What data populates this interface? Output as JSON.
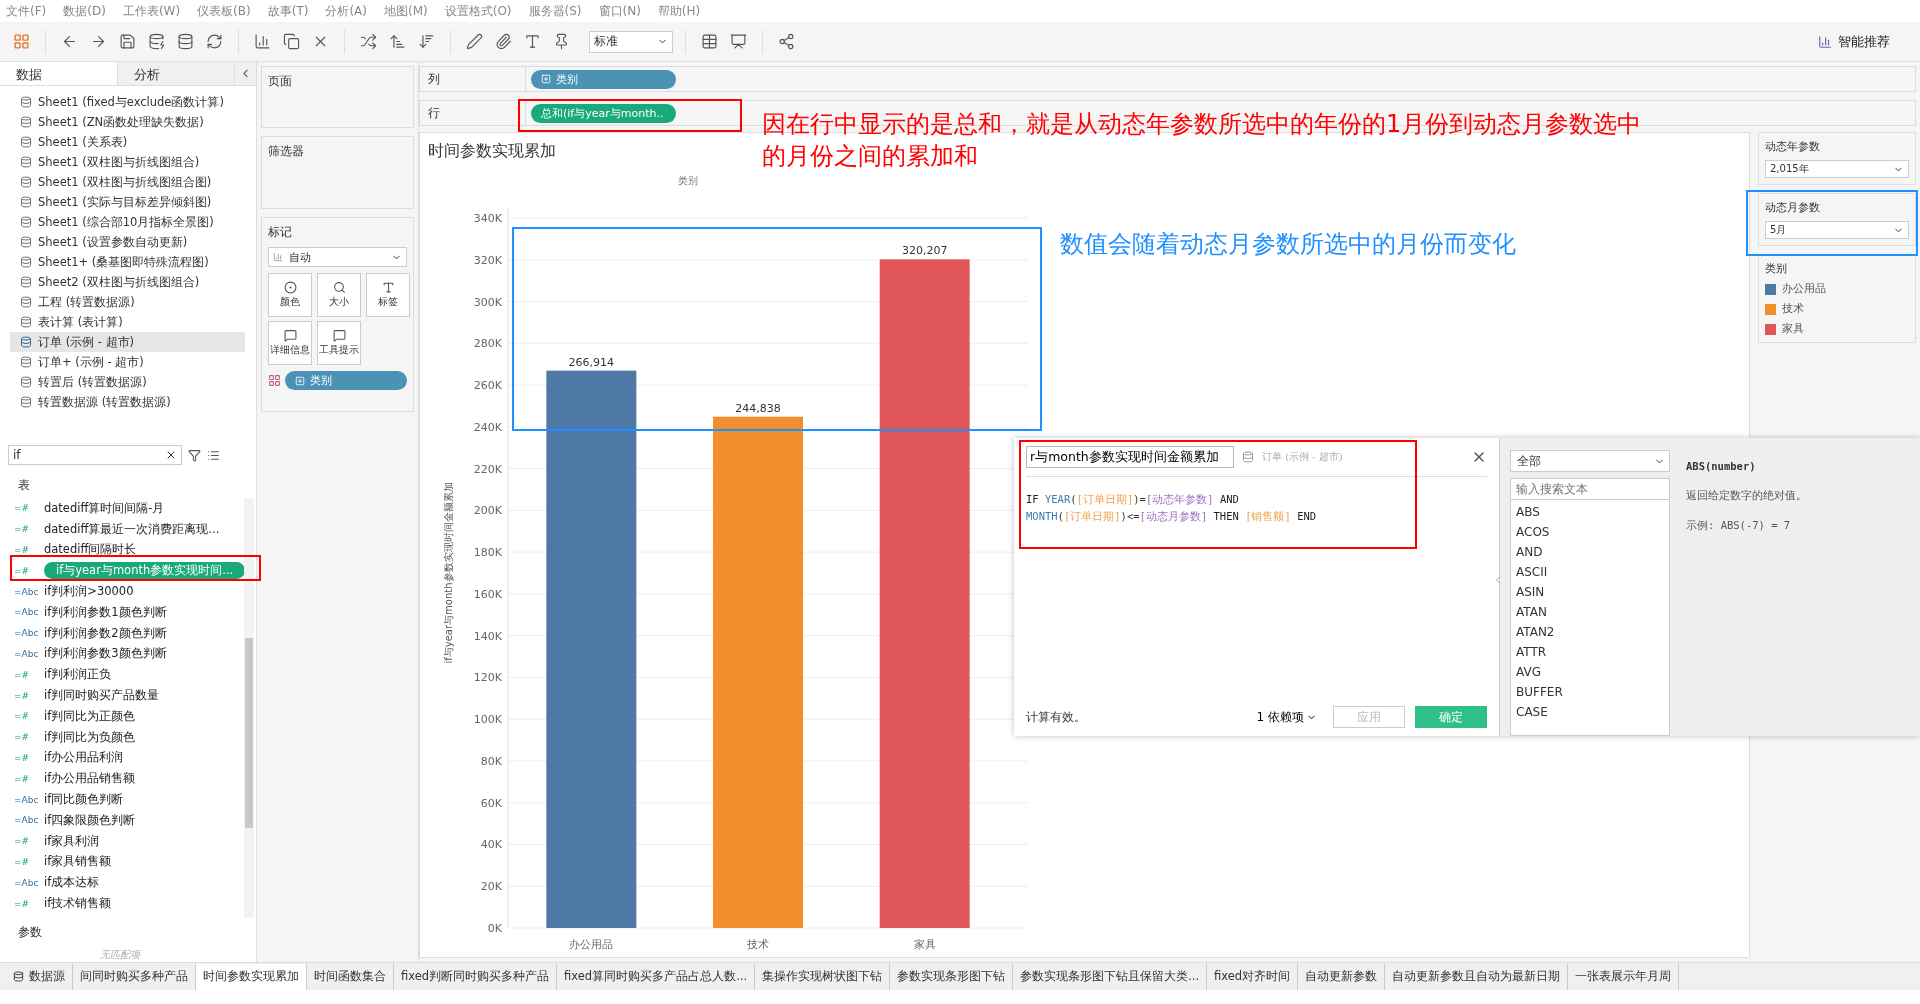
{
  "menu": [
    "文件(F)",
    "数据(D)",
    "工作表(W)",
    "仪表板(B)",
    "故事(T)",
    "分析(A)",
    "地图(M)",
    "设置格式(O)",
    "服务器(S)",
    "窗口(N)",
    "帮助(H)"
  ],
  "toolbar": {
    "fit_select": "标准",
    "smart_button": "智能推荐"
  },
  "data_pane": {
    "tabs": [
      {
        "label": "数据",
        "selected": true
      },
      {
        "label": "分析",
        "selected": false
      }
    ],
    "sources": [
      {
        "name": "Sheet1 (fixed与exclude函数计算)",
        "selected": false
      },
      {
        "name": "Sheet1 (ZN函数处理缺失数据)",
        "selected": false
      },
      {
        "name": "Sheet1 (关系表)",
        "selected": false
      },
      {
        "name": "Sheet1 (双柱图与折线图组合)",
        "selected": false
      },
      {
        "name": "Sheet1 (双柱图与折线图组合图)",
        "selected": false
      },
      {
        "name": "Sheet1 (实际与目标差异倾斜图)",
        "selected": false
      },
      {
        "name": "Sheet1 (综合部10月指标全景图)",
        "selected": false
      },
      {
        "name": "Sheet1 (设置参数自动更新)",
        "selected": false
      },
      {
        "name": "Sheet1+ (桑基图即特殊流程图)",
        "selected": false
      },
      {
        "name": "Sheet2 (双柱图与折线图组合)",
        "selected": false
      },
      {
        "name": "工程 (转置数据源)",
        "selected": false
      },
      {
        "name": "表计算 (表计算)",
        "selected": false
      },
      {
        "name": "订单 (示例 - 超市)",
        "selected": true
      },
      {
        "name": "订单+ (示例 - 超市)",
        "selected": false
      },
      {
        "name": "转置后 (转置数据源)",
        "selected": false
      },
      {
        "name": "转置数据源 (转置数据源)",
        "selected": false
      }
    ],
    "search": {
      "value": "if"
    },
    "table_heading": "表",
    "fields": [
      {
        "kind": "measure",
        "type_icon": "=#",
        "name": "datediff算时间间隔-月",
        "selected": false
      },
      {
        "kind": "measure",
        "type_icon": "=#",
        "name": "datediff算最近一次消费距离现...",
        "selected": false
      },
      {
        "kind": "measure",
        "type_icon": "=#",
        "name": "datediff间隔时长",
        "selected": false
      },
      {
        "kind": "measure",
        "type_icon": "=#",
        "name": "if与year与month参数实现时间...",
        "selected": true
      },
      {
        "kind": "dimension",
        "type_icon": "=Abc",
        "name": "if判利润>30000",
        "selected": false
      },
      {
        "kind": "dimension",
        "type_icon": "=Abc",
        "name": "if判利润参数1颜色判断",
        "selected": false
      },
      {
        "kind": "dimension",
        "type_icon": "=Abc",
        "name": "if判利润参数2颜色判断",
        "selected": false
      },
      {
        "kind": "dimension",
        "type_icon": "=Abc",
        "name": "if判利润参数3颜色判断",
        "selected": false
      },
      {
        "kind": "measure",
        "type_icon": "=#",
        "name": "if判利润正负",
        "selected": false
      },
      {
        "kind": "measure",
        "type_icon": "=#",
        "name": "if判同时购买产品数量",
        "selected": false
      },
      {
        "kind": "measure",
        "type_icon": "=#",
        "name": "if判同比为正颜色",
        "selected": false
      },
      {
        "kind": "measure",
        "type_icon": "=#",
        "name": "if判同比为负颜色",
        "selected": false
      },
      {
        "kind": "measure",
        "type_icon": "=#",
        "name": "if办公用品利润",
        "selected": false
      },
      {
        "kind": "measure",
        "type_icon": "=#",
        "name": "if办公用品销售额",
        "selected": false
      },
      {
        "kind": "dimension",
        "type_icon": "=Abc",
        "name": "if同比颜色判断",
        "selected": false
      },
      {
        "kind": "dimension",
        "type_icon": "=Abc",
        "name": "if四象限颜色判断",
        "selected": false
      },
      {
        "kind": "measure",
        "type_icon": "=#",
        "name": "if家具利润",
        "selected": false
      },
      {
        "kind": "measure",
        "type_icon": "=#",
        "name": "if家具销售额",
        "selected": false
      },
      {
        "kind": "dimension",
        "type_icon": "=Abc",
        "name": "if成本达标",
        "selected": false
      },
      {
        "kind": "measure",
        "type_icon": "=#",
        "name": "if技术销售额",
        "selected": false
      }
    ],
    "params_heading": "参数",
    "no_match": "无匹配项"
  },
  "cards": {
    "pages": "页面",
    "filters": "筛选器",
    "marks": {
      "title": "标记",
      "mark_type": "自动",
      "buttons": [
        "颜色",
        "大小",
        "标签",
        "详细信息",
        "工具提示"
      ],
      "pill": "类别"
    }
  },
  "shelves": [
    {
      "label": "列",
      "pill": "类别",
      "kind": "dimension"
    },
    {
      "label": "行",
      "pill": "总和(if与year与month..",
      "kind": "measure"
    }
  ],
  "view": {
    "title": "时间参数实现累加",
    "header": "类别",
    "chart_data": {
      "type": "bar",
      "ylabel": "if与year与month参数实现时间金额累加",
      "categories": [
        "办公用品",
        "技术",
        "家具"
      ],
      "grid": true,
      "series": [
        {
          "values": [
            266914,
            244838,
            320207
          ],
          "colors": [
            "#4e79a7",
            "#f28e2b",
            "#e15759"
          ]
        }
      ],
      "value_labels": [
        "266,914",
        "244,838",
        "320,207"
      ],
      "ylim": [
        0,
        340000
      ],
      "yticks": [
        {
          "value": 0,
          "label": "0K"
        },
        {
          "value": 20000,
          "label": "20K"
        },
        {
          "value": 40000,
          "label": "40K"
        },
        {
          "value": 60000,
          "label": "60K"
        },
        {
          "value": 80000,
          "label": "80K"
        },
        {
          "value": 100000,
          "label": "100K"
        },
        {
          "value": 120000,
          "label": "120K"
        },
        {
          "value": 140000,
          "label": "140K"
        },
        {
          "value": 160000,
          "label": "160K"
        },
        {
          "value": 180000,
          "label": "180K"
        },
        {
          "value": 200000,
          "label": "200K"
        },
        {
          "value": 220000,
          "label": "220K"
        },
        {
          "value": 240000,
          "label": "240K"
        },
        {
          "value": 260000,
          "label": "260K"
        },
        {
          "value": 280000,
          "label": "280K"
        },
        {
          "value": 300000,
          "label": "300K"
        },
        {
          "value": 320000,
          "label": "320K"
        },
        {
          "value": 340000,
          "label": "340K"
        }
      ]
    }
  },
  "parameters": [
    {
      "label": "动态年参数",
      "value": "2,015年"
    },
    {
      "label": "动态月参数",
      "value": "5月"
    }
  ],
  "legend": {
    "title": "类别",
    "items": [
      {
        "label": "办公用品",
        "color": "#4e79a7"
      },
      {
        "label": "技术",
        "color": "#f28e2b"
      },
      {
        "label": "家具",
        "color": "#e15759"
      }
    ]
  },
  "calc_dialog": {
    "name": "r与month参数实现时间金额累加",
    "source": "订单 (示例 - 超市)",
    "formula": [
      [
        {
          "kind": "keyword",
          "text": "IF "
        },
        {
          "kind": "function",
          "text": "YEAR"
        },
        {
          "kind": "operator",
          "text": "("
        },
        {
          "kind": "field",
          "text": "[订单日期]"
        },
        {
          "kind": "operator",
          "text": ")="
        },
        {
          "kind": "parameter",
          "text": "[动态年参数]"
        },
        {
          "kind": "keyword",
          "text": " AND"
        }
      ],
      [
        {
          "kind": "function",
          "text": "MONTH"
        },
        {
          "kind": "operator",
          "text": "("
        },
        {
          "kind": "field",
          "text": "[订单日期]"
        },
        {
          "kind": "operator",
          "text": ")<="
        },
        {
          "kind": "parameter",
          "text": "[动态月参数]"
        },
        {
          "kind": "keyword",
          "text": " THEN "
        },
        {
          "kind": "field",
          "text": "[销售额]"
        },
        {
          "kind": "keyword",
          "text": " END"
        }
      ]
    ],
    "status": "计算有效。",
    "dependencies": "1 依赖项",
    "buttons": [
      {
        "label": "应用",
        "kind": "secondary",
        "disabled": true
      },
      {
        "label": "确定",
        "kind": "primary",
        "disabled": false
      }
    ],
    "category": "全部",
    "search_placeholder": "输入搜索文本",
    "functions": [
      "ABS",
      "ACOS",
      "AND",
      "ASCII",
      "ASIN",
      "ATAN",
      "ATAN2",
      "ATTR",
      "AVG",
      "BUFFER",
      "CASE"
    ],
    "help": {
      "signature": "ABS(number)",
      "description": "返回给定数字的绝对值。",
      "example": "示例: ABS(-7) = 7"
    }
  },
  "sheet_tabs": [
    {
      "label": "数据源",
      "kind": "datasource",
      "selected": false
    },
    {
      "label": "间同时购买多种产品",
      "kind": "sheet",
      "selected": false
    },
    {
      "label": "时间参数实现累加",
      "kind": "sheet",
      "selected": true
    },
    {
      "label": "时间函数集合",
      "kind": "sheet",
      "selected": false
    },
    {
      "label": "fixed判断同时购买多种产品",
      "kind": "sheet",
      "selected": false
    },
    {
      "label": "fixed算同时购买多产品占总人数...",
      "kind": "sheet",
      "selected": false
    },
    {
      "label": "集操作实现树状图下钻",
      "kind": "sheet",
      "selected": false
    },
    {
      "label": "参数实现条形图下钻",
      "kind": "sheet",
      "selected": false
    },
    {
      "label": "参数实现条形图下钻且保留大类...",
      "kind": "sheet",
      "selected": false
    },
    {
      "label": "fixed对齐时间",
      "kind": "sheet",
      "selected": false
    },
    {
      "label": "自动更新参数",
      "kind": "sheet",
      "selected": false
    },
    {
      "label": "自动更新参数且自动为最新日期",
      "kind": "sheet",
      "selected": false
    },
    {
      "label": "一张表展示年月周",
      "kind": "sheet",
      "selected": false
    }
  ],
  "annotations": [
    {
      "kind": "box",
      "color": "#ff0000"
    },
    {
      "kind": "note",
      "color": "#ff0000",
      "text": "因在行中显示的是总和，就是从动态年参数所选中的年份的1月份到动态月参数选中的月份之间的累加和"
    },
    {
      "kind": "box",
      "color": "#1e90ff"
    },
    {
      "kind": "note",
      "color": "#1e90ff",
      "text": "数值会随着动态月参数所选中的月份而变化"
    },
    {
      "kind": "box",
      "color": "#1e90ff"
    },
    {
      "kind": "box",
      "color": "#ff0000"
    },
    {
      "kind": "box",
      "color": "#ff0000"
    }
  ]
}
